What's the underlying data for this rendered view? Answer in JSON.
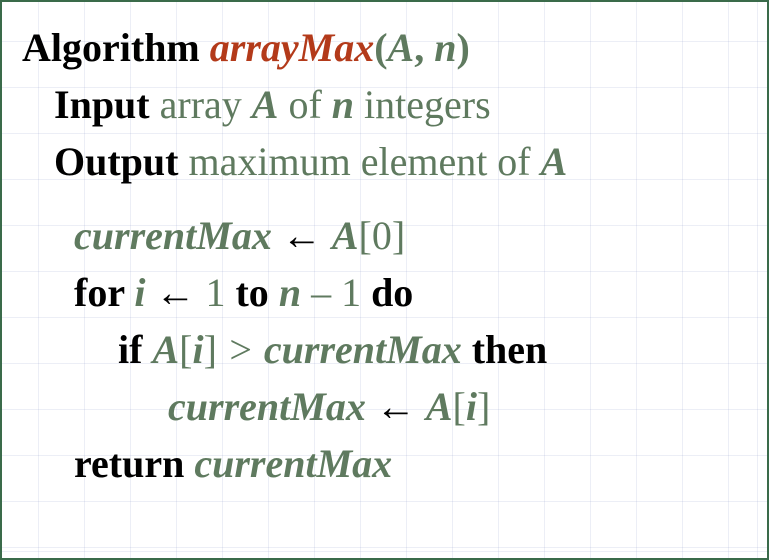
{
  "header": {
    "kw_algorithm": "Algorithm",
    "name": "arrayMax",
    "paren_open": "(",
    "paramA": "A",
    "comma": ", ",
    "paramN": "n",
    "paren_close": ")"
  },
  "input": {
    "kw": "Input",
    "t1": " array ",
    "A": "A",
    "t2": " of ",
    "n": "n",
    "t3": " integers"
  },
  "output": {
    "kw": "Output",
    "t1": " maximum element of ",
    "A": "A"
  },
  "line_init": {
    "cm": "currentMax",
    "arrow": " ← ",
    "A": "A",
    "br_open": "[",
    "zero": "0",
    "br_close": "]"
  },
  "line_for": {
    "kw_for": "for ",
    "i": "i",
    "arrow": " ← ",
    "one": "1",
    "kw_to": " to ",
    "n": "n",
    "minus": " – ",
    "one2": "1",
    "kw_do": " do"
  },
  "line_if": {
    "kw_if": "if ",
    "A": "A",
    "br_open": "[",
    "i": "i",
    "br_close": "]",
    "gt": " > ",
    "cm": "currentMax",
    "kw_then": " then"
  },
  "line_assign": {
    "cm": "currentMax",
    "arrow": " ← ",
    "A": "A",
    "br_open": "[",
    "i": "i",
    "br_close": "]"
  },
  "line_return": {
    "kw_return": "return ",
    "cm": "currentMax"
  }
}
